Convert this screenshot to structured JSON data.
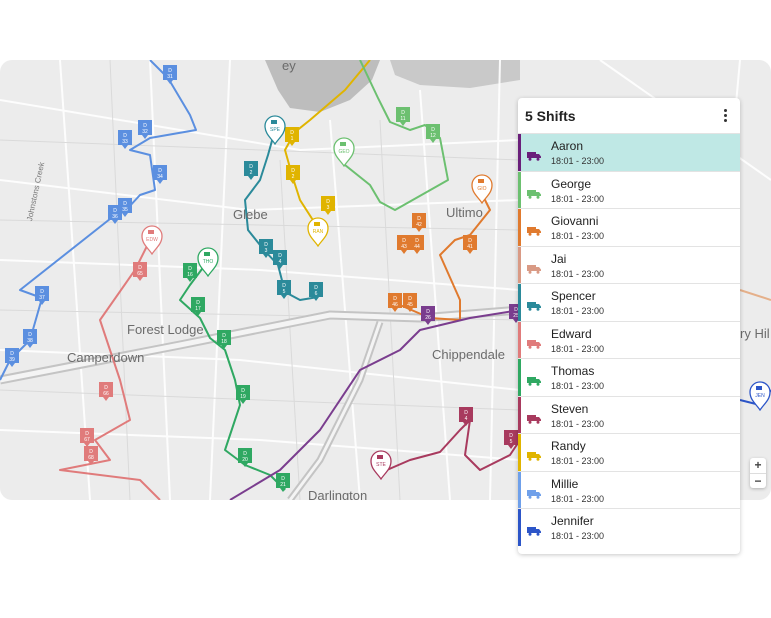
{
  "map": {
    "labels": {
      "glebe": "Glebe",
      "ultimo": "Ultimo",
      "forest_lodge": "Forest Lodge",
      "camperdown": "Camperdown",
      "chippendale": "Chippendale",
      "darlington": "Darlington",
      "surry_hills": "ry Hil",
      "johnstons_creek": "Johnstons Creek",
      "ey": "ey"
    },
    "depot_labels": {
      "spe": "SPE",
      "gio": "GIO",
      "ran": "RAN",
      "edw": "EDW",
      "tho": "THO",
      "ste": "STE",
      "jen": "JEN",
      "geo": "GEO"
    },
    "stops": [
      {
        "n": "31",
        "c": "#5b8fe0"
      },
      {
        "n": "32",
        "c": "#5b8fe0"
      },
      {
        "n": "33",
        "c": "#5b8fe0"
      },
      {
        "n": "34",
        "c": "#5b8fe0"
      },
      {
        "n": "35",
        "c": "#5b8fe0"
      },
      {
        "n": "36",
        "c": "#5b8fe0"
      },
      {
        "n": "37",
        "c": "#5b8fe0"
      },
      {
        "n": "38",
        "c": "#5b8fe0"
      },
      {
        "n": "39",
        "c": "#5b8fe0"
      },
      {
        "n": "1",
        "c": "#e0b400"
      },
      {
        "n": "2",
        "c": "#e0b400"
      },
      {
        "n": "3",
        "c": "#e0b400"
      },
      {
        "n": "2",
        "c": "#2b8a9a"
      },
      {
        "n": "3",
        "c": "#2b8a9a"
      },
      {
        "n": "4",
        "c": "#2b8a9a"
      },
      {
        "n": "5",
        "c": "#2b8a9a"
      },
      {
        "n": "6",
        "c": "#2b8a9a"
      },
      {
        "n": "11",
        "c": "#6cc070"
      },
      {
        "n": "12",
        "c": "#6cc070"
      },
      {
        "n": "41",
        "c": "#e07a2e"
      },
      {
        "n": "42",
        "c": "#e07a2e"
      },
      {
        "n": "43",
        "c": "#e07a2e"
      },
      {
        "n": "44",
        "c": "#e07a2e"
      },
      {
        "n": "45",
        "c": "#e07a2e"
      },
      {
        "n": "46",
        "c": "#e07a2e"
      },
      {
        "n": "16",
        "c": "#2fa862"
      },
      {
        "n": "17",
        "c": "#2fa862"
      },
      {
        "n": "18",
        "c": "#2fa862"
      },
      {
        "n": "19",
        "c": "#2fa862"
      },
      {
        "n": "20",
        "c": "#2fa862"
      },
      {
        "n": "21",
        "c": "#2fa862"
      },
      {
        "n": "65",
        "c": "#e07b7b"
      },
      {
        "n": "66",
        "c": "#e07b7b"
      },
      {
        "n": "67",
        "c": "#e07b7b"
      },
      {
        "n": "68",
        "c": "#e07b7b"
      },
      {
        "n": "26",
        "c": "#7a3d8e"
      },
      {
        "n": "25",
        "c": "#7a3d8e"
      },
      {
        "n": "4",
        "c": "#a83a5e"
      },
      {
        "n": "5",
        "c": "#a83a5e"
      }
    ],
    "stop_prefix": "D",
    "zoom_in": "+",
    "zoom_out": "−"
  },
  "panel": {
    "title": "5 Shifts",
    "shifts": [
      {
        "name": "Aaron",
        "time": "18:01 - 23:00",
        "color": "#6a1f7a",
        "selected": true
      },
      {
        "name": "George",
        "time": "18:01 - 23:00",
        "color": "#6cc070"
      },
      {
        "name": "Giovanni",
        "time": "18:01 - 23:00",
        "color": "#e07a2e"
      },
      {
        "name": "Jai",
        "time": "18:01 - 23:00",
        "color": "#d99a85"
      },
      {
        "name": "Spencer",
        "time": "18:01 - 23:00",
        "color": "#2b8a9a"
      },
      {
        "name": "Edward",
        "time": "18:01 - 23:00",
        "color": "#e07b7b"
      },
      {
        "name": "Thomas",
        "time": "18:01 - 23:00",
        "color": "#2fa862"
      },
      {
        "name": "Steven",
        "time": "18:01 - 23:00",
        "color": "#a83a5e"
      },
      {
        "name": "Randy",
        "time": "18:01 - 23:00",
        "color": "#e0b400"
      },
      {
        "name": "Millie",
        "time": "18:01 - 23:00",
        "color": "#6fa0ea"
      },
      {
        "name": "Jennifer",
        "time": "18:01 - 23:00",
        "color": "#2c55c8"
      }
    ]
  }
}
